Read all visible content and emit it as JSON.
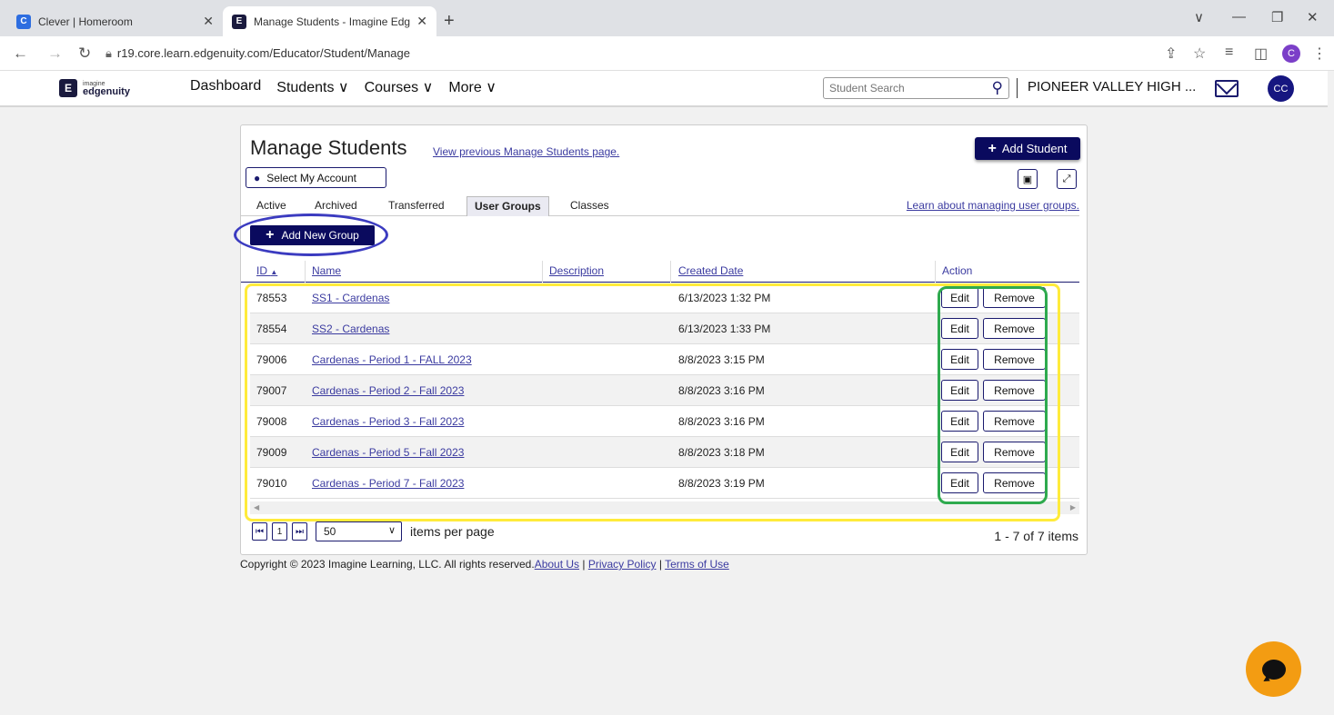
{
  "browser": {
    "tabs": [
      {
        "title": "Clever | Homeroom",
        "icon": "C"
      },
      {
        "title": "Manage Students - Imagine Edg",
        "icon": "E"
      }
    ],
    "url": "r19.core.learn.edgenuity.com/Educator/Student/Manage",
    "profile_initial": "C"
  },
  "header": {
    "logo_top": "imagine",
    "logo_bottom": "edgenuity",
    "nav": [
      "Dashboard",
      "Students ∨",
      "Courses ∨",
      "More ∨"
    ],
    "search_placeholder": "Student Search",
    "school": "PIONEER VALLEY HIGH ...",
    "avatar": "CC"
  },
  "panel": {
    "title": "Manage Students",
    "previous_link": "View previous Manage Students page.",
    "add_student": "Add Student",
    "select_account": "Select My Account",
    "tabs": [
      "Active",
      "Archived",
      "Transferred",
      "User Groups",
      "Classes"
    ],
    "active_tab": "User Groups",
    "learn_link": "Learn about managing user groups.",
    "add_group": "Add New Group",
    "columns": {
      "id": "ID",
      "name": "Name",
      "description": "Description",
      "created": "Created Date",
      "action": "Action"
    },
    "rows": [
      {
        "id": "78553",
        "name": "SS1 - Cardenas",
        "description": "",
        "created": "6/13/2023 1:32 PM"
      },
      {
        "id": "78554",
        "name": "SS2 - Cardenas",
        "description": "",
        "created": "6/13/2023 1:33 PM"
      },
      {
        "id": "79006",
        "name": "Cardenas - Period 1 - FALL 2023",
        "description": "",
        "created": "8/8/2023 3:15 PM"
      },
      {
        "id": "79007",
        "name": "Cardenas - Period 2 - Fall 2023",
        "description": "",
        "created": "8/8/2023 3:16 PM"
      },
      {
        "id": "79008",
        "name": "Cardenas - Period 3 - Fall 2023",
        "description": "",
        "created": "8/8/2023 3:16 PM"
      },
      {
        "id": "79009",
        "name": "Cardenas - Period 5 - Fall 2023",
        "description": "",
        "created": "8/8/2023 3:18 PM"
      },
      {
        "id": "79010",
        "name": "Cardenas - Period 7 - Fall 2023",
        "description": "",
        "created": "8/8/2023 3:19 PM"
      }
    ],
    "edit_label": "Edit",
    "remove_label": "Remove",
    "pager": {
      "page": "1",
      "page_size": "50",
      "per_page_label": "items per page",
      "count": "1 - 7 of 7 items"
    }
  },
  "footer": {
    "copyright": "Copyright © 2023 Imagine Learning, LLC. All rights reserved.",
    "about": "About Us",
    "privacy": "Privacy Policy",
    "terms": "Terms of Use"
  },
  "colors": {
    "brand_navy": "#0a0a5e",
    "link": "#3b3ba0",
    "highlight_yellow": "#ffeb3b",
    "highlight_green": "#2eaa4e",
    "highlight_blue": "#3b3bc0",
    "chat_orange": "#f39c12"
  }
}
